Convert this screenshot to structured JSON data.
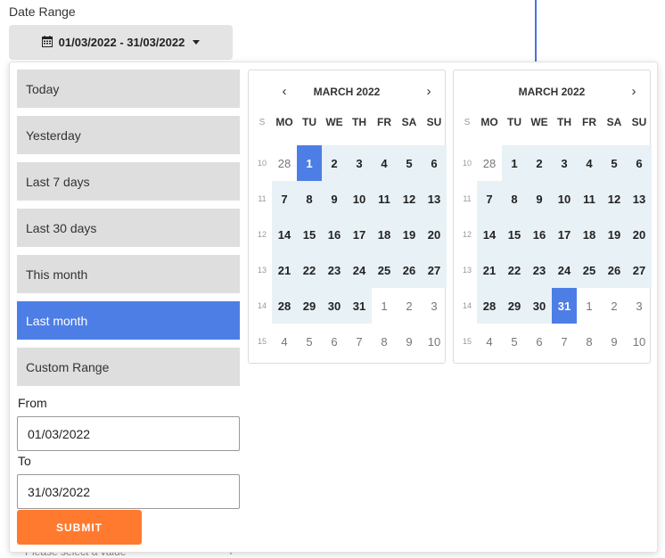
{
  "field_label": "Date Range",
  "range_button": {
    "value": "01/03/2022 - 31/03/2022",
    "icon": "calendar-icon"
  },
  "ranges": [
    {
      "label": "Today",
      "active": false
    },
    {
      "label": "Yesterday",
      "active": false
    },
    {
      "label": "Last 7 days",
      "active": false
    },
    {
      "label": "Last 30 days",
      "active": false
    },
    {
      "label": "This month",
      "active": false
    },
    {
      "label": "Last month",
      "active": true
    },
    {
      "label": "Custom Range",
      "active": false
    }
  ],
  "from": {
    "label": "From",
    "value": "01/03/2022"
  },
  "to": {
    "label": "To",
    "value": "31/03/2022"
  },
  "submit_label": "SUBMIT",
  "under_text": "Please select a value",
  "weekday_headers": [
    "S",
    "MO",
    "TU",
    "WE",
    "TH",
    "FR",
    "SA",
    "SU"
  ],
  "calendars": [
    {
      "title": "MARCH 2022",
      "prev": "‹",
      "next": "›",
      "weeks": [
        {
          "num": "10",
          "days": [
            "28",
            "1",
            "2",
            "3",
            "4",
            "5",
            "6"
          ]
        },
        {
          "num": "11",
          "days": [
            "7",
            "8",
            "9",
            "10",
            "11",
            "12",
            "13"
          ]
        },
        {
          "num": "12",
          "days": [
            "14",
            "15",
            "16",
            "17",
            "18",
            "19",
            "20"
          ]
        },
        {
          "num": "13",
          "days": [
            "21",
            "22",
            "23",
            "24",
            "25",
            "26",
            "27"
          ]
        },
        {
          "num": "14",
          "days": [
            "28",
            "29",
            "30",
            "31",
            "1",
            "2",
            "3"
          ]
        },
        {
          "num": "15",
          "days": [
            "4",
            "5",
            "6",
            "7",
            "8",
            "9",
            "10"
          ]
        }
      ],
      "selected_day": "1"
    },
    {
      "title": "MARCH 2022",
      "prev": "",
      "next": "›",
      "weeks": [
        {
          "num": "10",
          "days": [
            "28",
            "1",
            "2",
            "3",
            "4",
            "5",
            "6"
          ]
        },
        {
          "num": "11",
          "days": [
            "7",
            "8",
            "9",
            "10",
            "11",
            "12",
            "13"
          ]
        },
        {
          "num": "12",
          "days": [
            "14",
            "15",
            "16",
            "17",
            "18",
            "19",
            "20"
          ]
        },
        {
          "num": "13",
          "days": [
            "21",
            "22",
            "23",
            "24",
            "25",
            "26",
            "27"
          ]
        },
        {
          "num": "14",
          "days": [
            "28",
            "29",
            "30",
            "31",
            "1",
            "2",
            "3"
          ]
        },
        {
          "num": "15",
          "days": [
            "4",
            "5",
            "6",
            "7",
            "8",
            "9",
            "10"
          ]
        }
      ],
      "selected_day": "31"
    }
  ],
  "colors": {
    "accent": "#4d7ee6",
    "range_bg": "#e8f1f6",
    "submit": "#ff7a2f",
    "item_bg": "#dedede"
  }
}
